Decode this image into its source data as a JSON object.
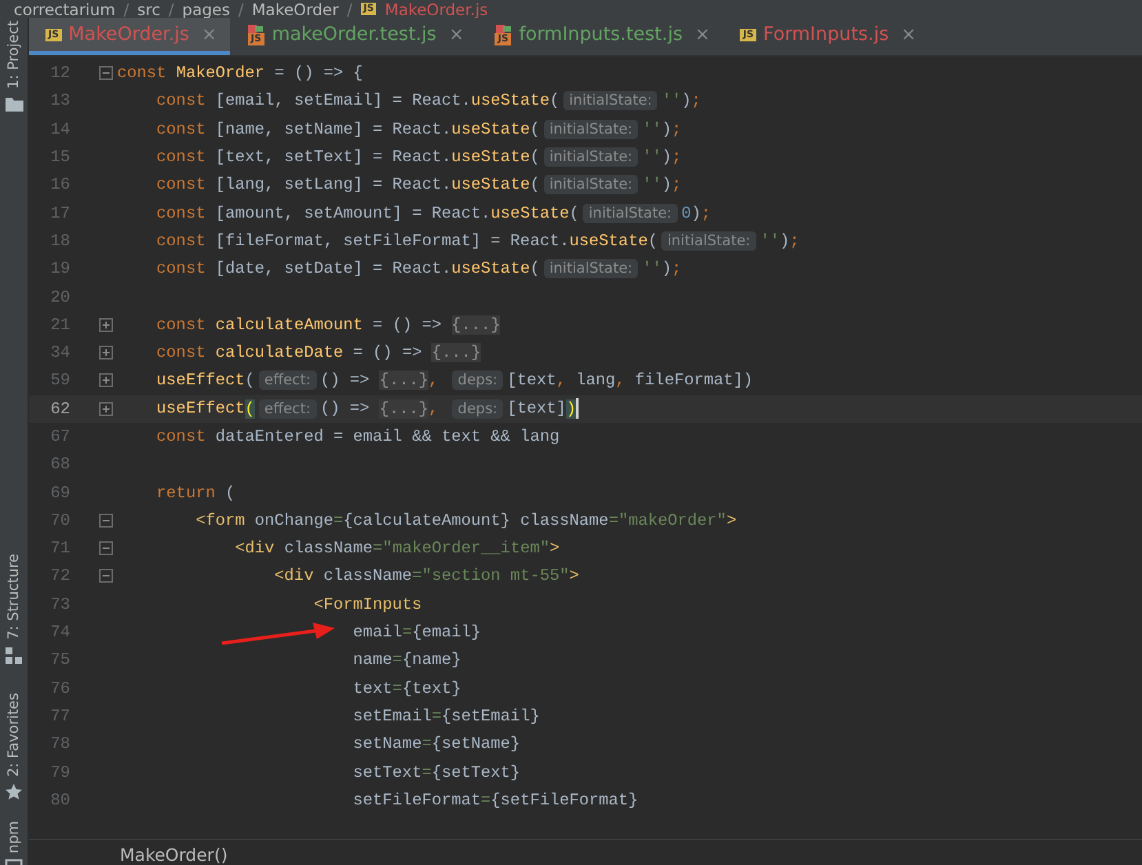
{
  "breadcrumb": [
    {
      "text": "correctarium",
      "kind": "folder"
    },
    {
      "text": "src",
      "kind": "folder",
      "separator": "/"
    },
    {
      "text": "pages",
      "kind": "folder",
      "separator": "/"
    },
    {
      "text": "MakeOrder",
      "kind": "folder",
      "separator": "/"
    },
    {
      "text": "MakeOrder.js",
      "kind": "file",
      "badge": "JS",
      "separator": "/"
    }
  ],
  "tabs": [
    {
      "label": "MakeOrder.js",
      "badge": "JS",
      "kind": "js",
      "color": "#d25252",
      "selected": true,
      "close": "×"
    },
    {
      "label": "makeOrder.test.js",
      "badge": "JS",
      "kind": "test",
      "color": "#62a362",
      "selected": false,
      "close": "×"
    },
    {
      "label": "formInputs.test.js",
      "badge": "JS",
      "kind": "test",
      "color": "#62a362",
      "selected": false,
      "close": "×"
    },
    {
      "label": "FormInputs.js",
      "badge": "JS",
      "kind": "js",
      "color": "#d25252",
      "selected": false,
      "close": "×"
    }
  ],
  "tool_strip": [
    {
      "label": "1: Project",
      "kind": "folder"
    },
    {
      "label": "7: Structure",
      "kind": "structure"
    },
    {
      "label": "2: Favorites",
      "kind": "star"
    },
    {
      "label": "npm",
      "kind": "npm"
    }
  ],
  "lines": [
    {
      "number": "12",
      "expanded": true,
      "current": false,
      "segments": [
        {
          "kind": "keyword",
          "text": "const "
        },
        {
          "kind": "function",
          "text": "MakeOrder"
        },
        {
          "kind": "plain",
          "text": " = () => {"
        }
      ],
      "children": [
        {
          "number": "13",
          "current": false,
          "segments": [
            {
              "kind": "keyword",
              "text": "const "
            },
            {
              "kind": "plain",
              "text": "[email, setEmail] = React."
            },
            {
              "kind": "function",
              "text": "useState"
            },
            {
              "kind": "plain",
              "text": "("
            },
            {
              "kind": "hint",
              "text": "initialState:"
            },
            {
              "kind": "string",
              "text": "''"
            },
            {
              "kind": "plain",
              "text": ")"
            },
            {
              "kind": "keyword",
              "text": ";"
            }
          ]
        },
        {
          "number": "14",
          "current": false,
          "segments": [
            {
              "kind": "keyword",
              "text": "const "
            },
            {
              "kind": "plain",
              "text": "[name, setName] = React."
            },
            {
              "kind": "function",
              "text": "useState"
            },
            {
              "kind": "plain",
              "text": "("
            },
            {
              "kind": "hint",
              "text": "initialState:"
            },
            {
              "kind": "string",
              "text": "''"
            },
            {
              "kind": "plain",
              "text": ")"
            },
            {
              "kind": "keyword",
              "text": ";"
            }
          ]
        },
        {
          "number": "15",
          "current": false,
          "segments": [
            {
              "kind": "keyword",
              "text": "const "
            },
            {
              "kind": "plain",
              "text": "[text, setText] = React."
            },
            {
              "kind": "function",
              "text": "useState"
            },
            {
              "kind": "plain",
              "text": "("
            },
            {
              "kind": "hint",
              "text": "initialState:"
            },
            {
              "kind": "string",
              "text": "''"
            },
            {
              "kind": "plain",
              "text": ")"
            },
            {
              "kind": "keyword",
              "text": ";"
            }
          ]
        },
        {
          "number": "16",
          "current": false,
          "segments": [
            {
              "kind": "keyword",
              "text": "const "
            },
            {
              "kind": "plain",
              "text": "[lang, setLang] = React."
            },
            {
              "kind": "function",
              "text": "useState"
            },
            {
              "kind": "plain",
              "text": "("
            },
            {
              "kind": "hint",
              "text": "initialState:"
            },
            {
              "kind": "string",
              "text": "''"
            },
            {
              "kind": "plain",
              "text": ")"
            },
            {
              "kind": "keyword",
              "text": ";"
            }
          ]
        },
        {
          "number": "17",
          "current": false,
          "segments": [
            {
              "kind": "keyword",
              "text": "const "
            },
            {
              "kind": "plain",
              "text": "[amount, setAmount] = React."
            },
            {
              "kind": "function",
              "text": "useState"
            },
            {
              "kind": "plain",
              "text": "("
            },
            {
              "kind": "hint",
              "text": "initialState:"
            },
            {
              "kind": "number",
              "text": "0"
            },
            {
              "kind": "plain",
              "text": ")"
            },
            {
              "kind": "keyword",
              "text": ";"
            }
          ]
        },
        {
          "number": "18",
          "current": false,
          "segments": [
            {
              "kind": "keyword",
              "text": "const "
            },
            {
              "kind": "plain",
              "text": "[fileFormat, setFileFormat] = React."
            },
            {
              "kind": "function",
              "text": "useState"
            },
            {
              "kind": "plain",
              "text": "("
            },
            {
              "kind": "hint",
              "text": "initialState:"
            },
            {
              "kind": "string",
              "text": "''"
            },
            {
              "kind": "plain",
              "text": ")"
            },
            {
              "kind": "keyword",
              "text": ";"
            }
          ]
        },
        {
          "number": "19",
          "current": false,
          "segments": [
            {
              "kind": "keyword",
              "text": "const "
            },
            {
              "kind": "plain",
              "text": "[date, setDate] = React."
            },
            {
              "kind": "function",
              "text": "useState"
            },
            {
              "kind": "plain",
              "text": "("
            },
            {
              "kind": "hint",
              "text": "initialState:"
            },
            {
              "kind": "string",
              "text": "''"
            },
            {
              "kind": "plain",
              "text": ")"
            },
            {
              "kind": "keyword",
              "text": ";"
            }
          ]
        },
        {
          "number": "20",
          "current": false
        },
        {
          "number": "21",
          "expanded": false,
          "current": false,
          "segments": [
            {
              "kind": "keyword",
              "text": "const "
            },
            {
              "kind": "function",
              "text": "calculateAmount"
            },
            {
              "kind": "plain",
              "text": " = () => "
            },
            {
              "kind": "folded",
              "text": "{...}"
            }
          ]
        },
        {
          "number": "34",
          "expanded": false,
          "current": false,
          "segments": [
            {
              "kind": "keyword",
              "text": "const "
            },
            {
              "kind": "function",
              "text": "calculateDate"
            },
            {
              "kind": "plain",
              "text": " = () => "
            },
            {
              "kind": "folded",
              "text": "{...}"
            }
          ]
        },
        {
          "number": "59",
          "expanded": false,
          "current": false,
          "segments": [
            {
              "kind": "function",
              "text": "useEffect"
            },
            {
              "kind": "plain",
              "text": "("
            },
            {
              "kind": "hint",
              "text": "effect:"
            },
            {
              "kind": "plain",
              "text": "() => "
            },
            {
              "kind": "folded",
              "text": "{...}"
            },
            {
              "kind": "keyword",
              "text": ", "
            },
            {
              "kind": "hint",
              "text": "deps:"
            },
            {
              "kind": "plain",
              "text": "[text"
            },
            {
              "kind": "keyword",
              "text": ", "
            },
            {
              "kind": "plain",
              "text": "lang"
            },
            {
              "kind": "keyword",
              "text": ", "
            },
            {
              "kind": "plain",
              "text": "fileFormat])"
            }
          ]
        },
        {
          "number": "62",
          "expanded": false,
          "current": true,
          "segments": [
            {
              "kind": "function",
              "text": "useEffect"
            },
            {
              "kind": "match",
              "text": "("
            },
            {
              "kind": "hint",
              "text": "effect:"
            },
            {
              "kind": "plain",
              "text": "() => "
            },
            {
              "kind": "folded",
              "text": "{...}"
            },
            {
              "kind": "keyword",
              "text": ", "
            },
            {
              "kind": "hint",
              "text": "deps:"
            },
            {
              "kind": "plain",
              "text": "[text]"
            },
            {
              "kind": "match",
              "text": ")"
            }
          ]
        },
        {
          "number": "67",
          "current": false,
          "segments": [
            {
              "kind": "keyword",
              "text": "const "
            },
            {
              "kind": "plain",
              "text": "dataEntered = email && text && lang"
            }
          ]
        },
        {
          "number": "68",
          "current": false
        },
        {
          "number": "69",
          "current": false,
          "segments": [
            {
              "kind": "keyword",
              "text": "return "
            },
            {
              "kind": "plain",
              "text": "("
            }
          ],
          "children": [
            {
              "number": "70",
              "expanded": true,
              "current": false,
              "segments": [
                {
                  "kind": "tag",
                  "text": "<form "
                },
                {
                  "kind": "plain",
                  "text": "onChange"
                },
                {
                  "kind": "string",
                  "text": "="
                },
                {
                  "kind": "plain",
                  "text": "{calculateAmount} className"
                },
                {
                  "kind": "string",
                  "text": "=\"makeOrder\""
                },
                {
                  "kind": "tag",
                  "text": ">"
                }
              ],
              "children": [
                {
                  "number": "71",
                  "expanded": true,
                  "current": false,
                  "segments": [
                    {
                      "kind": "tag",
                      "text": "<div "
                    },
                    {
                      "kind": "plain",
                      "text": "className"
                    },
                    {
                      "kind": "string",
                      "text": "=\"makeOrder__item\""
                    },
                    {
                      "kind": "tag",
                      "text": ">"
                    }
                  ],
                  "children": [
                    {
                      "number": "72",
                      "expanded": true,
                      "current": false,
                      "segments": [
                        {
                          "kind": "tag",
                          "text": "<div "
                        },
                        {
                          "kind": "plain",
                          "text": "className"
                        },
                        {
                          "kind": "string",
                          "text": "=\"section mt-55\""
                        },
                        {
                          "kind": "tag",
                          "text": ">"
                        }
                      ],
                      "children": [
                        {
                          "number": "73",
                          "current": false,
                          "segments": [
                            {
                              "kind": "tag",
                              "text": "<FormInputs"
                            }
                          ],
                          "children": [
                            {
                              "number": "74",
                              "current": false,
                              "segments": [
                                {
                                  "kind": "plain",
                                  "text": "email"
                                },
                                {
                                  "kind": "string",
                                  "text": "="
                                },
                                {
                                  "kind": "plain",
                                  "text": "{email}"
                                }
                              ]
                            },
                            {
                              "number": "75",
                              "current": false,
                              "segments": [
                                {
                                  "kind": "plain",
                                  "text": "name"
                                },
                                {
                                  "kind": "string",
                                  "text": "="
                                },
                                {
                                  "kind": "plain",
                                  "text": "{name}"
                                }
                              ]
                            },
                            {
                              "number": "76",
                              "current": false,
                              "segments": [
                                {
                                  "kind": "plain",
                                  "text": "text"
                                },
                                {
                                  "kind": "string",
                                  "text": "="
                                },
                                {
                                  "kind": "plain",
                                  "text": "{text}"
                                }
                              ]
                            },
                            {
                              "number": "77",
                              "current": false,
                              "segments": [
                                {
                                  "kind": "plain",
                                  "text": "setEmail"
                                },
                                {
                                  "kind": "string",
                                  "text": "="
                                },
                                {
                                  "kind": "plain",
                                  "text": "{setEmail}"
                                }
                              ]
                            },
                            {
                              "number": "78",
                              "current": false,
                              "segments": [
                                {
                                  "kind": "plain",
                                  "text": "setName"
                                },
                                {
                                  "kind": "string",
                                  "text": "="
                                },
                                {
                                  "kind": "plain",
                                  "text": "{setName}"
                                }
                              ]
                            },
                            {
                              "number": "79",
                              "current": false,
                              "segments": [
                                {
                                  "kind": "plain",
                                  "text": "setText"
                                },
                                {
                                  "kind": "string",
                                  "text": "="
                                },
                                {
                                  "kind": "plain",
                                  "text": "{setText}"
                                }
                              ]
                            },
                            {
                              "number": "80",
                              "current": false,
                              "segments": [
                                {
                                  "kind": "plain",
                                  "text": "setFileFormat"
                                },
                                {
                                  "kind": "string",
                                  "text": "="
                                },
                                {
                                  "kind": "plain",
                                  "text": "{setFileFormat}"
                                }
                              ]
                            }
                          ]
                        }
                      ]
                    }
                  ]
                }
              ]
            }
          ]
        }
      ]
    }
  ],
  "status_crumb": "MakeOrder()"
}
